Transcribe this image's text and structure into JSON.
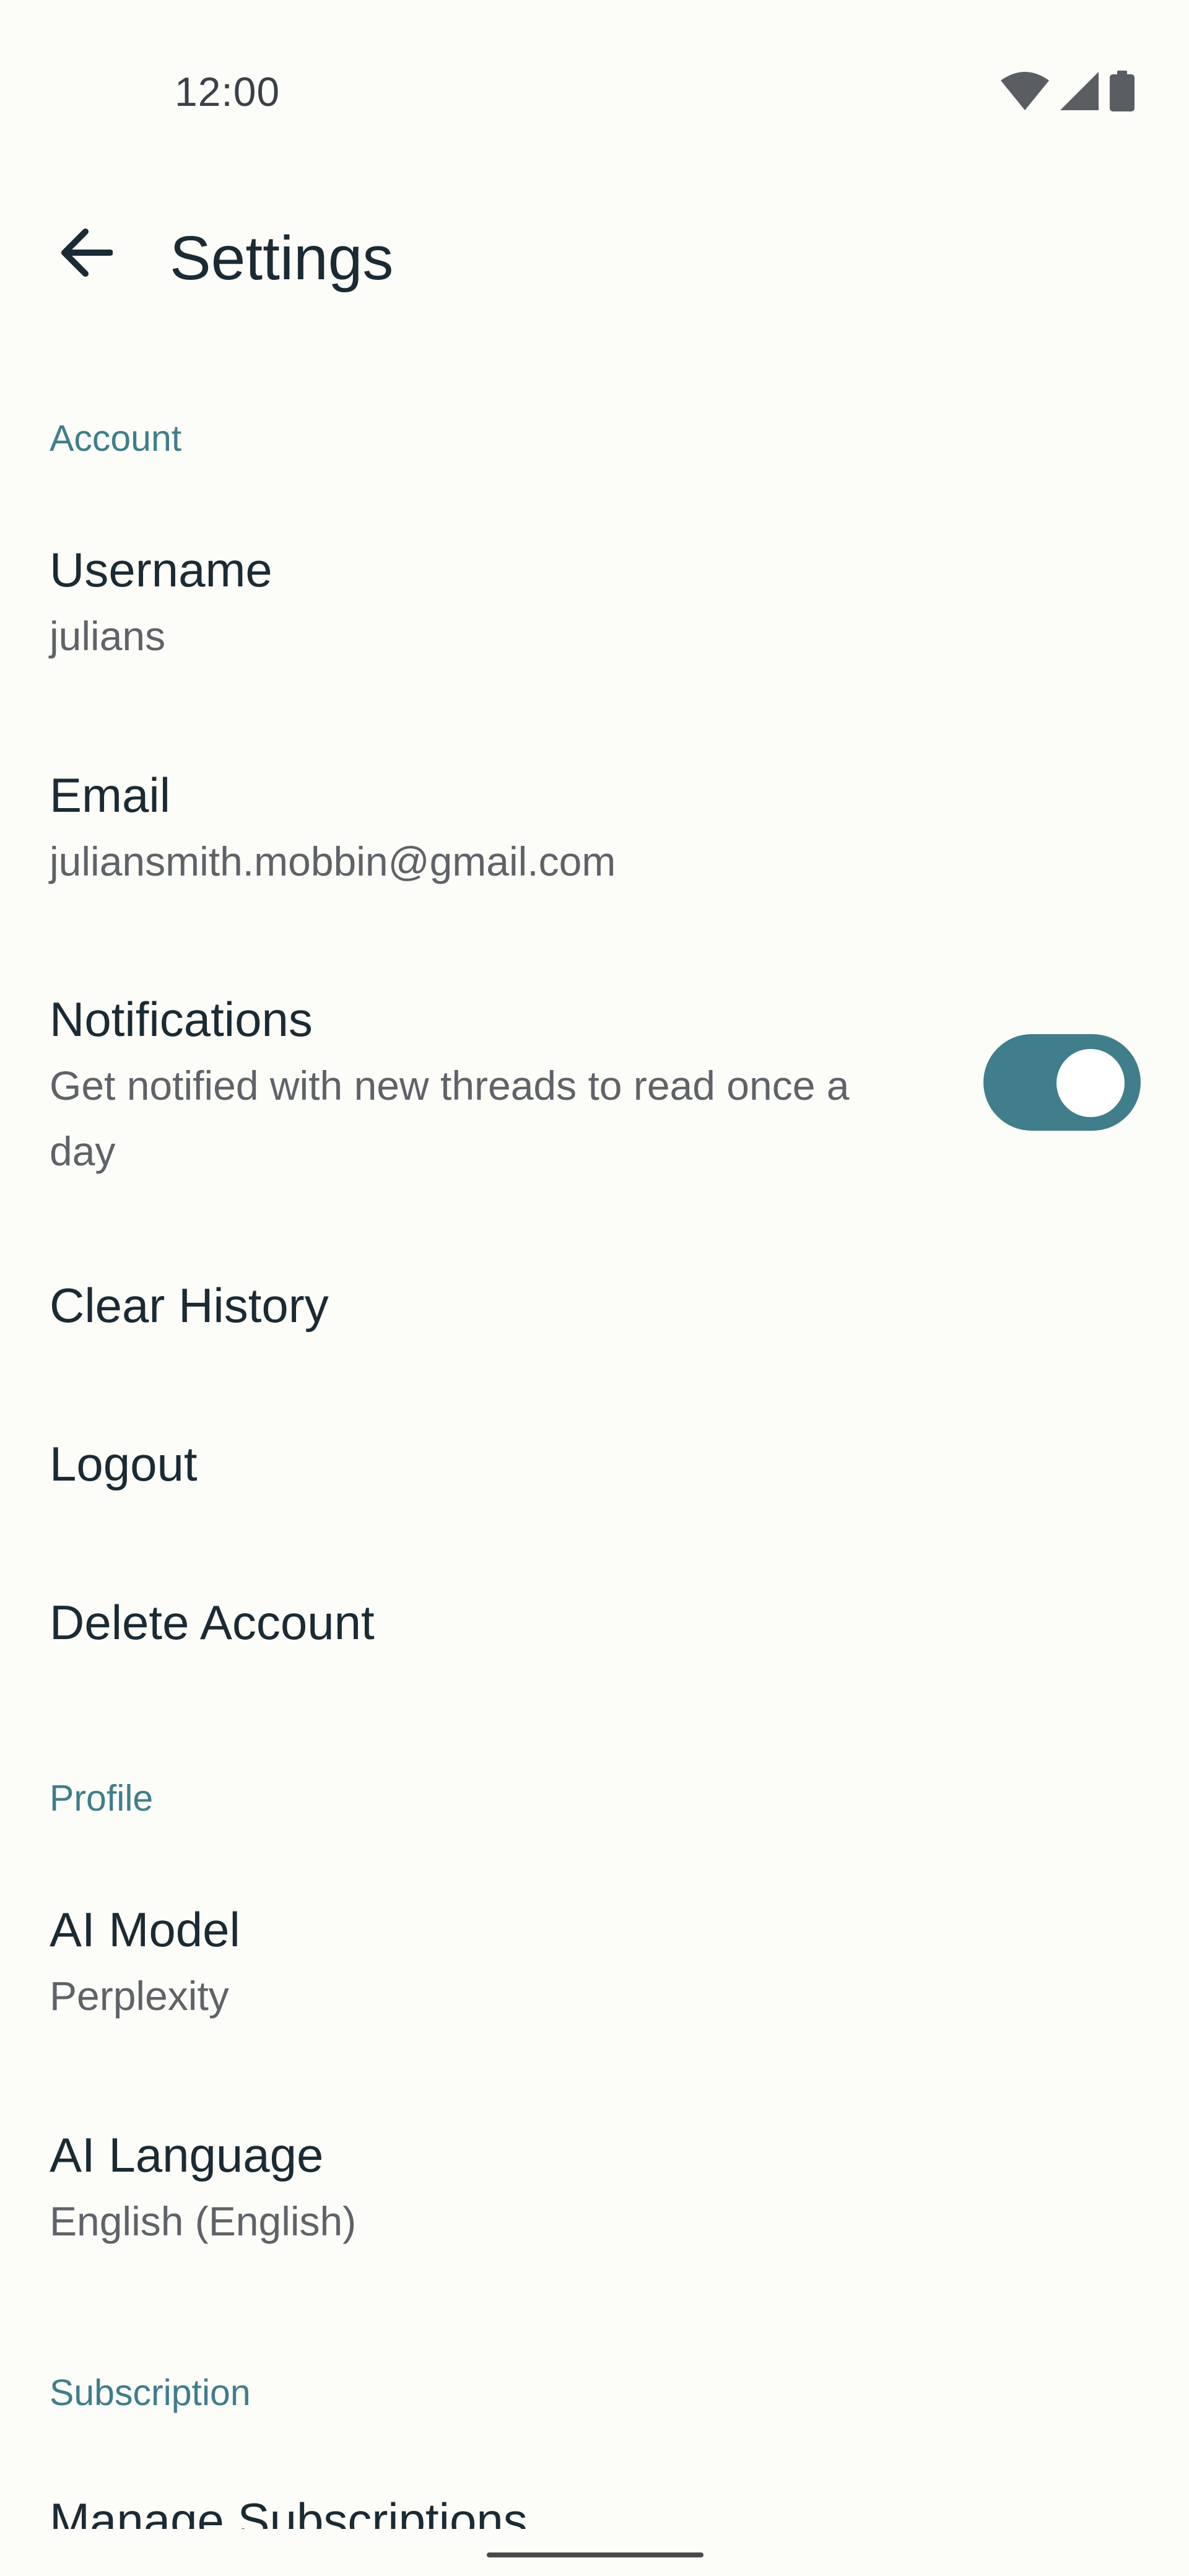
{
  "status_bar": {
    "time": "12:00",
    "icons": [
      "wifi-icon",
      "signal-icon",
      "battery-icon"
    ]
  },
  "app_bar": {
    "title": "Settings",
    "back_icon": "arrow-left-icon"
  },
  "sections": {
    "account": {
      "header": "Account",
      "username": {
        "title": "Username",
        "value": "julians"
      },
      "email": {
        "title": "Email",
        "value": "juliansmith.mobbin@gmail.com"
      },
      "notifications": {
        "title": "Notifications",
        "line1": "Get notified with new threads to read once a",
        "line2": "day",
        "enabled": true
      },
      "clear_history": "Clear History",
      "logout": "Logout",
      "delete_account": "Delete Account"
    },
    "profile": {
      "header": "Profile",
      "ai_model": {
        "title": "AI Model",
        "value": "Perplexity"
      },
      "ai_language": {
        "title": "AI Language",
        "value": "English (English)"
      }
    },
    "subscription": {
      "header": "Subscription",
      "manage": "Manage Subscriptions"
    }
  },
  "colors": {
    "background": "#FCFCF8",
    "accent": "#3F7E8A",
    "primary_text": "#1B2A33",
    "secondary_text": "#5F6368"
  }
}
